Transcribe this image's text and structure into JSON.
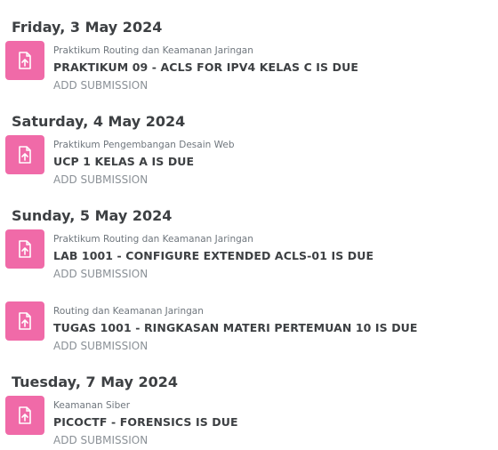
{
  "days": [
    {
      "date_label": "Friday, 3 May 2024",
      "events": [
        {
          "icon": "assignment-upload-icon",
          "course": "Praktikum Routing dan Keamanan Jaringan",
          "title": "PRAKTIKUM 09 - ACLS FOR IPV4 KELAS C IS DUE",
          "action": "ADD SUBMISSION"
        }
      ]
    },
    {
      "date_label": "Saturday, 4 May 2024",
      "events": [
        {
          "icon": "assignment-upload-icon",
          "course": "Praktikum Pengembangan Desain Web",
          "title": "UCP 1 KELAS A IS DUE",
          "action": "ADD SUBMISSION"
        }
      ]
    },
    {
      "date_label": "Sunday, 5 May 2024",
      "events": [
        {
          "icon": "assignment-upload-icon",
          "course": "Praktikum Routing dan Keamanan Jaringan",
          "title": "LAB 1001 - CONFIGURE EXTENDED ACLS-01 IS DUE",
          "action": "ADD SUBMISSION"
        },
        {
          "icon": "assignment-upload-icon",
          "course": "Routing dan Keamanan Jaringan",
          "title": "TUGAS 1001 - RINGKASAN MATERI PERTEMUAN 10 IS DUE",
          "action": "ADD SUBMISSION"
        }
      ]
    },
    {
      "date_label": "Tuesday, 7 May 2024",
      "events": [
        {
          "icon": "assignment-upload-icon",
          "course": "Keamanan Siber",
          "title": "PICOCTF - FORENSICS IS DUE",
          "action": "ADD SUBMISSION"
        }
      ]
    }
  ],
  "colors": {
    "icon_background": "#f06aa8",
    "heading": "#3d4043",
    "muted": "#6f767d"
  }
}
